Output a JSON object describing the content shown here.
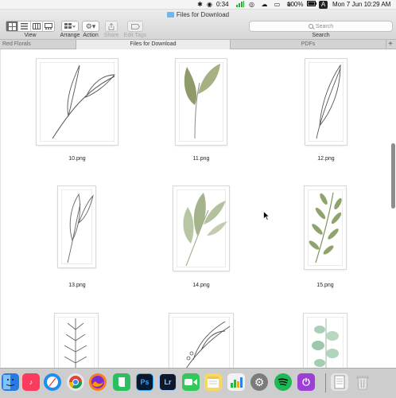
{
  "menubar": {
    "battery_percent": "100%",
    "timer_label": "0:34",
    "app_badge": "A",
    "datetime": "Mon 7 Jun  10:29 AM"
  },
  "window": {
    "title": "Files for Download",
    "toolbar": {
      "view_label": "View",
      "arrange_label": "Arrange",
      "action_label": "Action",
      "share_label": "Share",
      "edit_tags_label": "Edit Tags",
      "search_label": "Search",
      "search_placeholder": "Search"
    },
    "tabs": [
      {
        "label": "Red Florals",
        "active": false
      },
      {
        "label": "Files for Download",
        "active": true
      },
      {
        "label": "PDFs",
        "active": false
      }
    ],
    "add_tab_symbol": "+"
  },
  "files": [
    {
      "name": "10.png"
    },
    {
      "name": "11.png"
    },
    {
      "name": "12.png"
    },
    {
      "name": "13.png"
    },
    {
      "name": "14.png"
    },
    {
      "name": "15.png"
    },
    {
      "name": ""
    },
    {
      "name": ""
    },
    {
      "name": ""
    }
  ],
  "dock": {
    "apps": [
      {
        "name": "finder",
        "icon": "finder-icon",
        "color": "#2a7ae4",
        "glyph": ""
      },
      {
        "name": "music",
        "icon": "music-icon",
        "color": "#fb3b5c",
        "glyph": "♪"
      },
      {
        "name": "safari",
        "icon": "safari-icon",
        "color": "#1b8ef0",
        "glyph": ""
      },
      {
        "name": "chrome",
        "icon": "chrome-icon",
        "color": "#e8e8e8",
        "glyph": ""
      },
      {
        "name": "firefox",
        "icon": "firefox-icon",
        "color": "#ff7a1a",
        "glyph": ""
      },
      {
        "name": "evernote",
        "icon": "evernote-icon",
        "color": "#2dbe60",
        "glyph": ""
      },
      {
        "name": "photoshop",
        "icon": "photoshop-icon",
        "color": "#0a1a2e",
        "glyph": "Ps"
      },
      {
        "name": "lightroom",
        "icon": "lightroom-icon",
        "color": "#0e1a2b",
        "glyph": "Lr"
      },
      {
        "name": "facetime",
        "icon": "facetime-icon",
        "color": "#34c759",
        "glyph": ""
      },
      {
        "name": "notes",
        "icon": "notes-icon",
        "color": "#f6d865",
        "glyph": ""
      },
      {
        "name": "numbers",
        "icon": "numbers-icon",
        "color": "#f2f2f2",
        "glyph": ""
      },
      {
        "name": "system-preferences",
        "icon": "gear-icon",
        "color": "#7b7b7b",
        "glyph": "⚙"
      },
      {
        "name": "spotify",
        "icon": "spotify-icon",
        "color": "#1db954",
        "glyph": ""
      },
      {
        "name": "podcasts",
        "icon": "podcasts-icon",
        "color": "#9b3fd6",
        "glyph": "⏻"
      },
      {
        "name": "documents",
        "icon": "document-stack-icon",
        "color": "#e6e6e6",
        "glyph": ""
      },
      {
        "name": "trash",
        "icon": "trash-icon",
        "color": "#d9d9d9",
        "glyph": ""
      }
    ]
  }
}
